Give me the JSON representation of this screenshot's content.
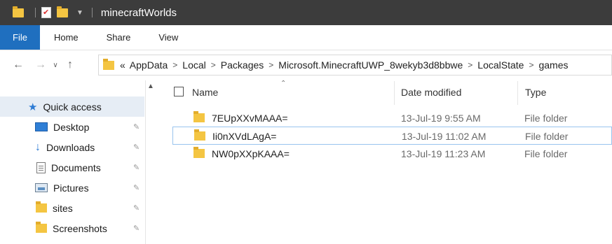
{
  "window": {
    "title": "minecraftWorlds"
  },
  "ribbon": {
    "tabs": [
      "File",
      "Home",
      "Share",
      "View"
    ]
  },
  "address": {
    "prefix": "«",
    "crumbs": [
      "AppData",
      "Local",
      "Packages",
      "Microsoft.MinecraftUWP_8wekyb3d8bbwe",
      "LocalState",
      "games"
    ]
  },
  "nav": {
    "quick_access": "Quick access",
    "items": [
      {
        "label": "Desktop",
        "icon": "desktop-icon"
      },
      {
        "label": "Downloads",
        "icon": "download-icon"
      },
      {
        "label": "Documents",
        "icon": "documents-icon"
      },
      {
        "label": "Pictures",
        "icon": "pictures-icon"
      },
      {
        "label": "sites",
        "icon": "folder-icon"
      },
      {
        "label": "Screenshots",
        "icon": "folder-icon"
      }
    ]
  },
  "columns": {
    "name": "Name",
    "date": "Date modified",
    "type": "Type"
  },
  "files": [
    {
      "name": "7EUpXXvMAAA=",
      "date": "13-Jul-19 9:55 AM",
      "type": "File folder"
    },
    {
      "name": "Ii0nXVdLAgA=",
      "date": "13-Jul-19 11:02 AM",
      "type": "File folder"
    },
    {
      "name": "NW0pXXpKAAA=",
      "date": "13-Jul-19 11:23 AM",
      "type": "File folder"
    }
  ],
  "colors": {
    "titlebar": "#3c3c3c",
    "file_tab": "#1f6fbf",
    "folder": "#f4c542",
    "selection_border": "#99c4ee",
    "quick_access_bg": "#e6edf5"
  }
}
